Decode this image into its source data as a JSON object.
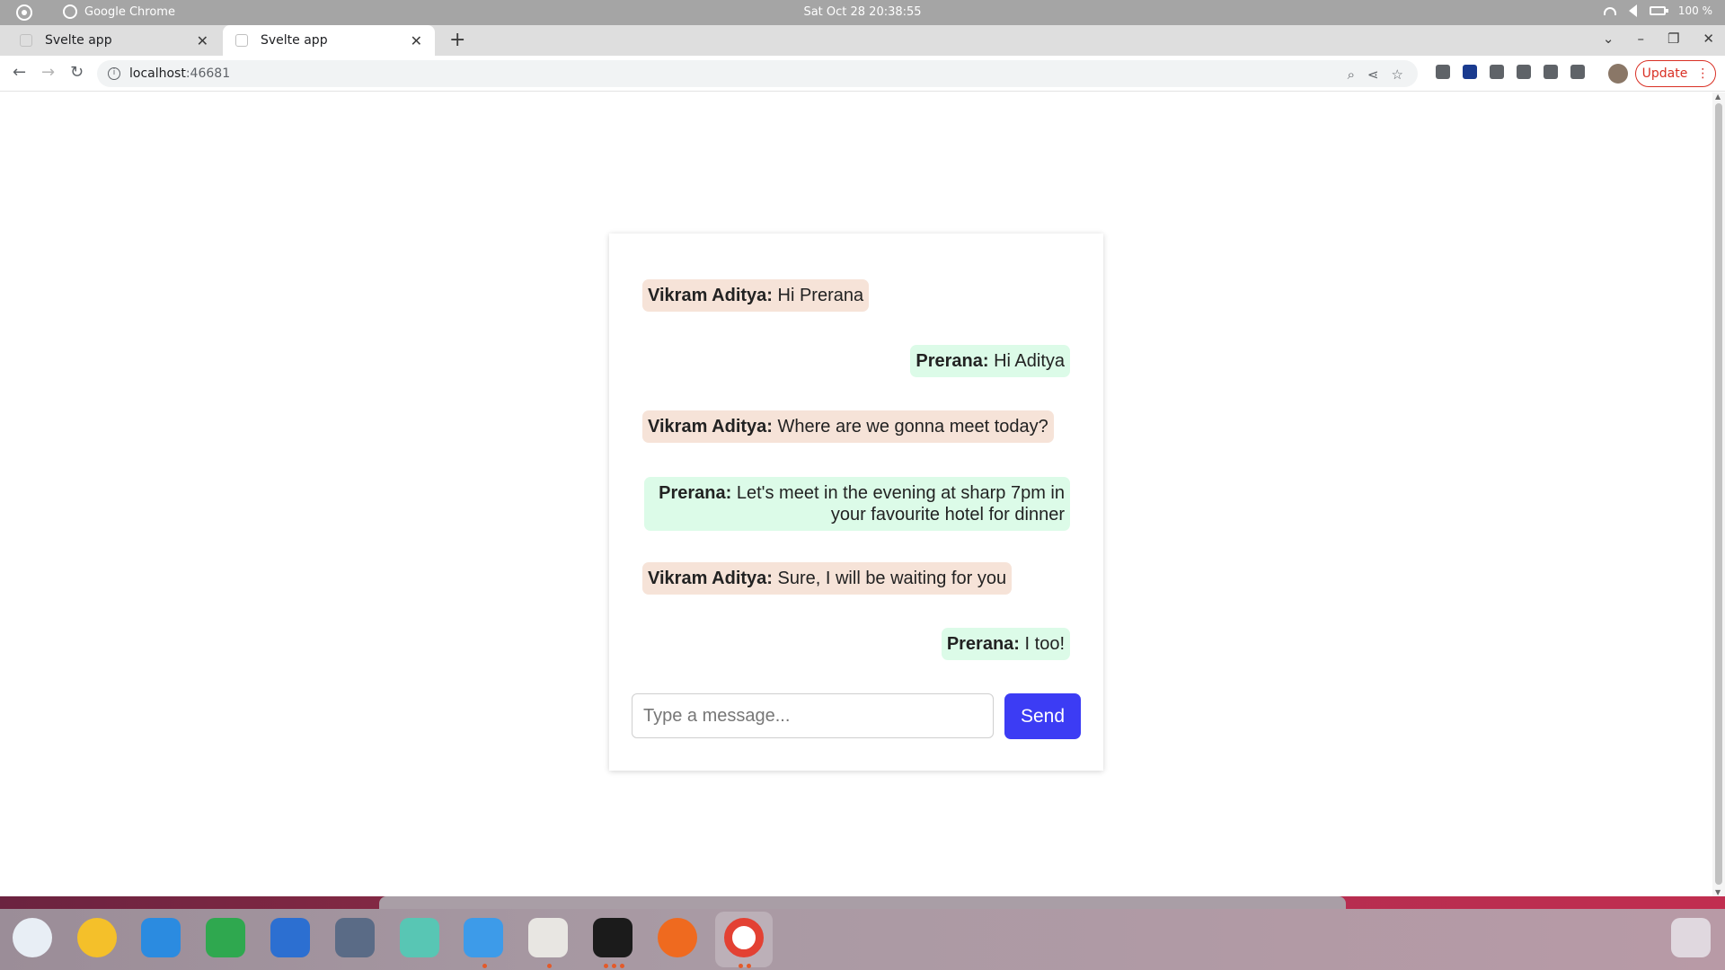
{
  "system_bar": {
    "app_name": "Google Chrome",
    "datetime": "Sat Oct 28  20:38:55",
    "battery": "100 %"
  },
  "tabs": [
    {
      "title": "Svelte app",
      "active": false
    },
    {
      "title": "Svelte app",
      "active": true
    }
  ],
  "address_bar": {
    "url_host": "localhost",
    "url_port": ":46681",
    "update_label": "Update"
  },
  "chat": {
    "messages": [
      {
        "sender": "Vikram Aditya:",
        "text": " Hi Prerana",
        "side": "left"
      },
      {
        "sender": "Prerana:",
        "text": " Hi Aditya",
        "side": "right"
      },
      {
        "sender": "Vikram Aditya:",
        "text": " Where are we gonna meet today?",
        "side": "left"
      },
      {
        "sender": "Prerana:",
        "text": " Let's meet in the evening at sharp 7pm in your favourite hotel for dinner",
        "side": "right"
      },
      {
        "sender": "Vikram Aditya:",
        "text": " Sure, I will be waiting for you",
        "side": "left"
      },
      {
        "sender": "Prerana:",
        "text": " I too!",
        "side": "right"
      }
    ],
    "input_placeholder": "Type a message...",
    "send_label": "Send"
  },
  "colors": {
    "left_bubble": "#f6e3d8",
    "right_bubble": "#dcfbe8",
    "send_button": "#3c3cf4",
    "update_red": "#d93025"
  },
  "dock": {
    "apps": [
      "thunderbird-icon",
      "rhythmbox-icon",
      "app-center-icon",
      "spreadsheet-icon",
      "writer-icon",
      "screenshot-icon",
      "help-icon",
      "finder-icon",
      "text-editor-icon",
      "terminal-icon",
      "firefox-icon",
      "chrome-icon",
      "app-grid-icon"
    ]
  }
}
